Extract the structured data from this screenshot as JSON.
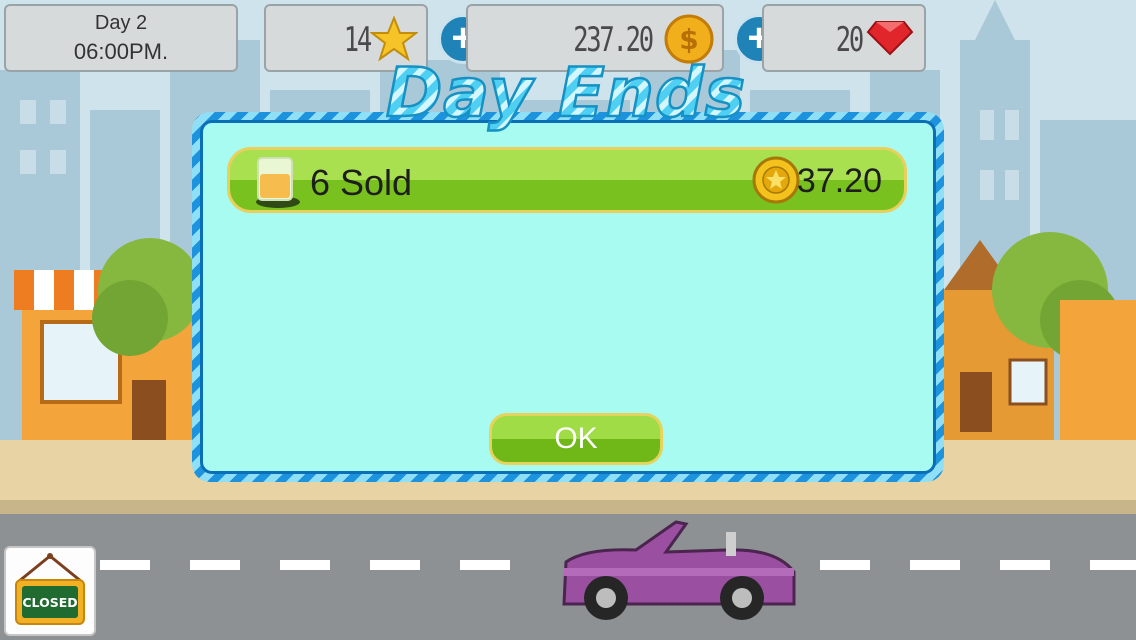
{
  "hud": {
    "day_label": "Day 2",
    "time_label": "06:00PM.",
    "stars": "14",
    "coins": "237.20",
    "gems": "20"
  },
  "dialog": {
    "title": "Day Ends",
    "sold_label": "6 Sold",
    "sold_amount": "37.20",
    "ok_label": "OK"
  },
  "closed_sign": "CLOSED",
  "icons": {
    "star": "star-icon",
    "coin": "dollar-coin-icon",
    "gem": "red-gem-icon",
    "plus": "plus-icon",
    "drink": "lemonade-cup-icon",
    "sold_coin": "star-coin-icon"
  },
  "colors": {
    "accent_blue": "#1f83b8",
    "panel_cyan": "#a8fbf0",
    "button_green": "#79c11f",
    "title_cyan": "#37c6ef"
  }
}
